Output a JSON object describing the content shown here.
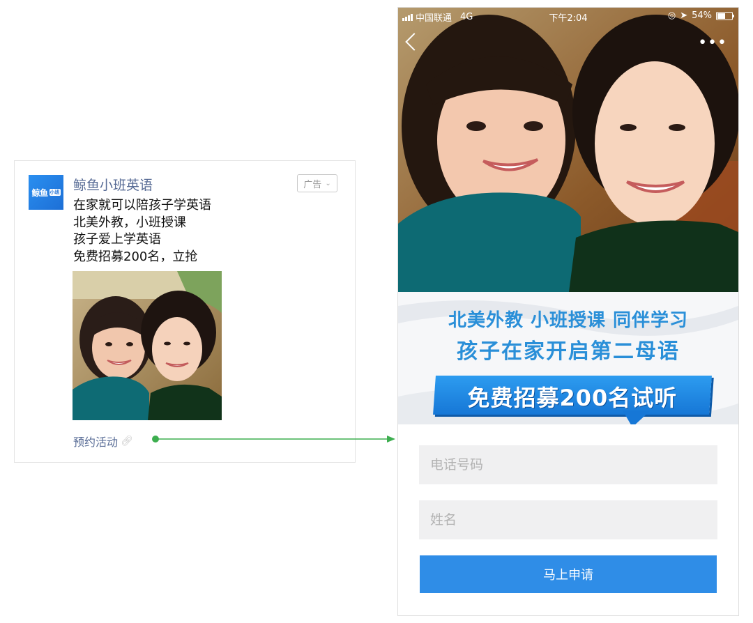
{
  "ad_card": {
    "logo_text": "鲸鱼",
    "logo_badge": "小班",
    "account_name": "鲸鱼小班英语",
    "ad_tag": "广告",
    "ad_tag_icon": "chevron-down-icon",
    "body_lines": [
      "在家就可以陪孩子学英语",
      "北美外教，小班授课",
      "孩子爱上学英语",
      "免费招募200名，立抢"
    ],
    "link_label": "预约活动",
    "link_icon": "link-icon"
  },
  "landing_page": {
    "status_bar": {
      "carrier": "中国联通",
      "network": "4G",
      "time": "下午2:04",
      "battery": "54%"
    },
    "headline_1": "北美外教  小班授课  同伴学习",
    "headline_2": "孩子在家开启第二母语",
    "promo": "免费招募200名试听",
    "phone_placeholder": "电话号码",
    "name_placeholder": "姓名",
    "submit_label": "马上申请"
  },
  "colors": {
    "link_blue": "#576b95",
    "brand_blue": "#2f8de7",
    "arrow_green": "#3dae4f"
  }
}
